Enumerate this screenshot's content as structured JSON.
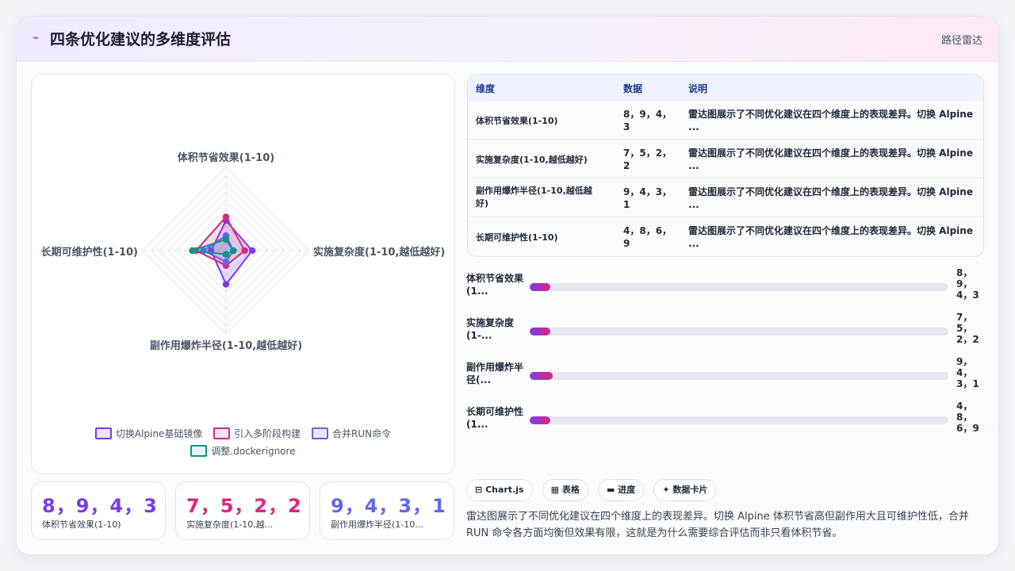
{
  "header": {
    "title": "四条优化建议的多维度评估",
    "tag": "路径雷达",
    "logo": "⌁"
  },
  "chart_data": {
    "type": "radar",
    "axes": [
      "体积节省效果(1-10)",
      "实施复杂度(1-10,越低越好)",
      "副作用爆炸半径(1-10,越低越好)",
      "长期可维护性(1-10)"
    ],
    "range": [
      0,
      10
    ],
    "series": [
      {
        "name": "切换Alpine基础镜像",
        "values": [
          8,
          7,
          9,
          4
        ],
        "color": "#7c3aed"
      },
      {
        "name": "引入多阶段构建",
        "values": [
          9,
          5,
          4,
          8
        ],
        "color": "#db2777"
      },
      {
        "name": "合并RUN命令",
        "values": [
          4,
          2,
          3,
          6
        ],
        "color": "#6366f1"
      },
      {
        "name": "调整.dockerignore",
        "values": [
          3,
          2,
          1,
          9
        ],
        "color": "#0d9488"
      }
    ],
    "legend": "bottom"
  },
  "stats": [
    {
      "value": "8，9，4，3",
      "label": "体积节省效果(1-10)",
      "color": "#7c3aed"
    },
    {
      "value": "7，5，2，2",
      "label": "实施复杂度(1-10,越...",
      "color": "#db2777"
    },
    {
      "value": "9，4，3，1",
      "label": "副作用爆炸半径(1-10...",
      "color": "#6366f1"
    }
  ],
  "table": {
    "headers": [
      "维度",
      "数据",
      "说明"
    ],
    "rows": [
      {
        "dim": "体积节省效果(1-10)",
        "data": [
          "8，9，4，",
          "3"
        ],
        "desc": [
          "雷达图展示了不同优化建议在四个维度上的表现差异。切换 Alpine",
          "..."
        ]
      },
      {
        "dim": "实施复杂度(1-10,越低越好)",
        "data": [
          "7，5，2，",
          "2"
        ],
        "desc": [
          "雷达图展示了不同优化建议在四个维度上的表现差异。切换 Alpine",
          "..."
        ]
      },
      {
        "dim": "副作用爆炸半径(1-10,越低越好)",
        "data": [
          "9，4，3，",
          "1"
        ],
        "desc": [
          "雷达图展示了不同优化建议在四个维度上的表现差异。切换 Alpine",
          "..."
        ]
      },
      {
        "dim": "长期可维护性(1-10)",
        "data": [
          "4，8，6，",
          "9"
        ],
        "desc": [
          "雷达图展示了不同优化建议在四个维度上的表现差异。切换 Alpine",
          "..."
        ]
      }
    ]
  },
  "bars": [
    {
      "label": "体积节省效果(1...",
      "value": [
        "8，",
        "9，",
        "4，3"
      ],
      "level": 0.05
    },
    {
      "label": "实施复杂度(1-...",
      "value": [
        "7，",
        "5，",
        "2，2"
      ],
      "level": 0.05
    },
    {
      "label": "副作用爆炸半径(...",
      "value": [
        "9，",
        "4，",
        "3，1"
      ],
      "level": 0.055
    },
    {
      "label": "长期可维护性(1...",
      "value": [
        "4，",
        "8，",
        "6，9"
      ],
      "level": 0.05
    }
  ],
  "pills": [
    {
      "icon": "⊟",
      "label": "Chart.js"
    },
    {
      "icon": "▦",
      "label": "表格"
    },
    {
      "icon": "▬",
      "label": "进度"
    },
    {
      "icon": "✦",
      "label": "数据卡片"
    }
  ],
  "summary": "雷达图展示了不同优化建议在四个维度上的表现差异。切换 Alpine 体积节省高但副作用大且可维护性低，合并 RUN 命令各方面均衡但效果有限，这就是为什么需要综合评估而非只看体积节省。"
}
